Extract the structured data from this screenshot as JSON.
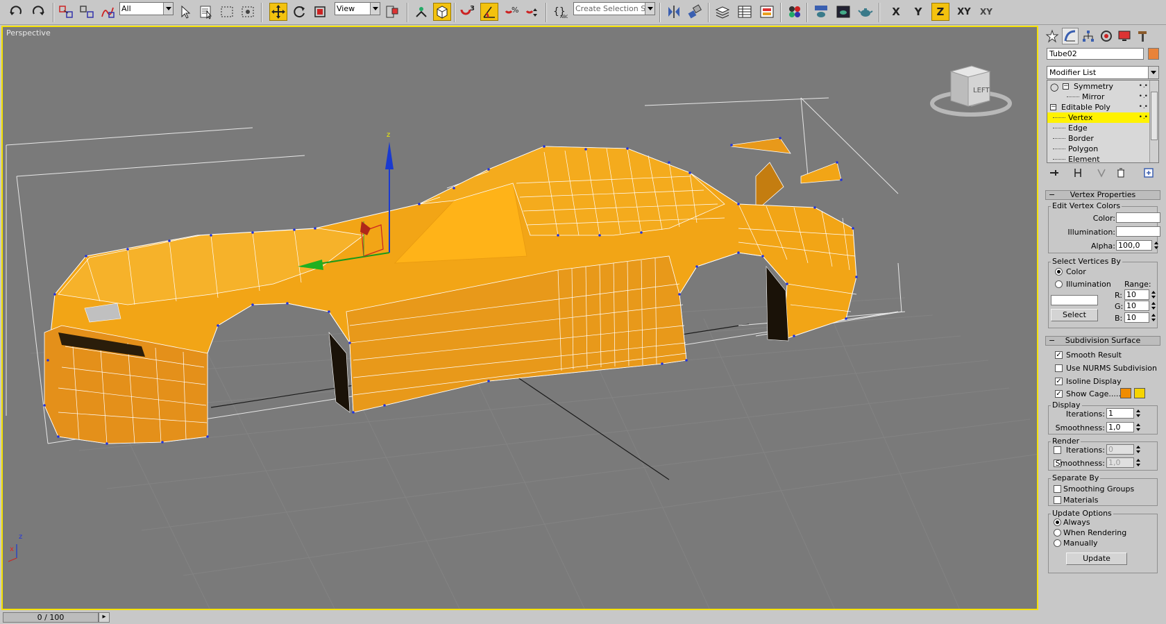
{
  "toolbar": {
    "selection_filter": "All",
    "ref_coord": "View",
    "named_selection": "Create Selection Set",
    "axis_x": "X",
    "axis_y": "Y",
    "axis_z": "Z",
    "axis_xy": "XY",
    "axis_xy2": "XY",
    "snap_3": "3",
    "active_tools": [
      "select-move",
      "angle-snap",
      "axis-z"
    ]
  },
  "viewport": {
    "label": "Perspective",
    "viewcube_face": "LEFT",
    "gizmo_axis_label": "z",
    "corner_axes": {
      "x": "x",
      "z": "z"
    },
    "mesh_color": "#f2a516",
    "vertex_color": "#2233dd",
    "background": "#7a7a7a"
  },
  "timeline": {
    "frame": "0 / 100"
  },
  "panel": {
    "object_name": "Tube02",
    "object_color": "#e8833a",
    "modifier_list": "Modifier List",
    "stack": [
      {
        "label": "Symmetry"
      },
      {
        "label": "Mirror"
      },
      {
        "label": "Editable Poly"
      },
      {
        "label": "Vertex",
        "selected": true
      },
      {
        "label": "Edge"
      },
      {
        "label": "Border"
      },
      {
        "label": "Polygon"
      },
      {
        "label": "Element"
      }
    ],
    "vertex_properties": {
      "title": "Vertex Properties",
      "edit_group": "Edit Vertex Colors",
      "color_label": "Color:",
      "illum_label": "Illumination:",
      "alpha_label": "Alpha:",
      "alpha_value": "100,0",
      "select_group": "Select Vertices By",
      "radio_color": "Color",
      "radio_illum": "Illumination",
      "range_label": "Range:",
      "r_label": "R:",
      "g_label": "G:",
      "b_label": "B:",
      "r_value": "10",
      "g_value": "10",
      "b_value": "10",
      "select_button": "Select"
    },
    "subdivision": {
      "title": "Subdivision Surface",
      "smooth_result": "Smooth Result",
      "use_nurms": "Use NURMS Subdivision",
      "isoline": "Isoline Display",
      "show_cage": "Show Cage......",
      "cage_color_1": "#f08c00",
      "cage_color_2": "#f6d400",
      "display_group": "Display",
      "iter_label": "Iterations:",
      "smooth_label": "Smoothness:",
      "display_iter": "1",
      "display_smooth": "1,0",
      "render_group": "Render",
      "render_iter": "0",
      "render_smooth": "1,0",
      "separate_group": "Separate By",
      "smoothing_groups": "Smoothing Groups",
      "materials": "Materials",
      "update_group": "Update Options",
      "always": "Always",
      "when_rendering": "When Rendering",
      "manually": "Manually",
      "update_button": "Update"
    }
  }
}
